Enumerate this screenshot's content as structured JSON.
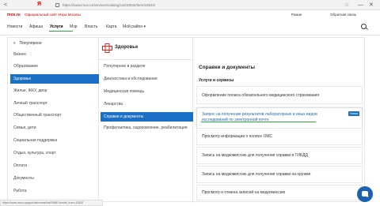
{
  "browser": {
    "nav_left": "<",
    "logo_main": "Я",
    "logo_accent": "Яндекс",
    "address": "https://www.mos.ru/services/catalog/cat/10532/item/16532/",
    "bookmark": "☆",
    "minimize": "—",
    "close": "✕"
  },
  "site": {
    "logo": "mos.ru",
    "title": "Официальный сайт Мэра Москвы",
    "user": "Роман",
    "feedback": "Обратная связь"
  },
  "menu": {
    "items": [
      "Новости",
      "Афиша",
      "Услуги",
      "Мэр",
      "Власть",
      "Карта",
      "Мой район"
    ],
    "active": "Услуги",
    "extra_chevron": "▾"
  },
  "categories": {
    "popular": "Популярное",
    "items": [
      "Бизнес",
      "Образование",
      "Здоровье",
      "Жилье, ЖКУ, двор",
      "Личный транспорт",
      "Общественный транспорт",
      "Семья, дети",
      "Социальная поддержка",
      "Отдых, культура, спорт",
      "Оплата",
      "Документы",
      "Работа"
    ],
    "active": "Здоровье"
  },
  "subcategories": {
    "title": "Здоровье",
    "items": [
      "Популярное в разделе",
      "Диагностика и обследования",
      "Медицинская помощь",
      "Лекарства",
      "Справки и документы",
      "Профилактика, оздоровление, реабилитация"
    ],
    "active": "Справки и документы"
  },
  "services": {
    "title": "Справки и документы",
    "section": "Услуги и сервисы",
    "items": [
      {
        "text": "Оформление полиса обязательного медицинского страхования",
        "lines": [
          "Оформление полиса обязательного медицинского страхования"
        ]
      },
      {
        "text": "Запрос на получение результатов лабораторных и иных видов исследований по электронной почте",
        "lines": [
          "Запрос на получение результатов лабораторных и иных видов",
          "исследований по электронной почте"
        ],
        "badge": "Новая"
      },
      {
        "text": "Просмотр информации о полисе ОМС",
        "lines": [
          "Просмотр информации о полисе ОМС"
        ]
      },
      {
        "text": "Запись на медкомиссию для получения справки в ГИБДД",
        "lines": [
          "Запись на медкомиссию для получения справки в ГИБДД"
        ]
      },
      {
        "text": "Запись на медкомиссию для получения справки на оружие",
        "lines": [
          "Запись на медкомиссию для получения справки на оружие"
        ]
      },
      {
        "text": "Просмотр и отмена записей на медкомиссию",
        "lines": [
          "Просмотр и отмена записей на медкомиссию"
        ]
      }
    ]
  },
  "status_bar": "https://www.mos.ru/pgu/ru/services/link/2968/?onsite_from=10532",
  "colors": {
    "accent_blue": "#1b6fc4",
    "green": "#2aaa3a",
    "brand_red": "#c00000"
  }
}
